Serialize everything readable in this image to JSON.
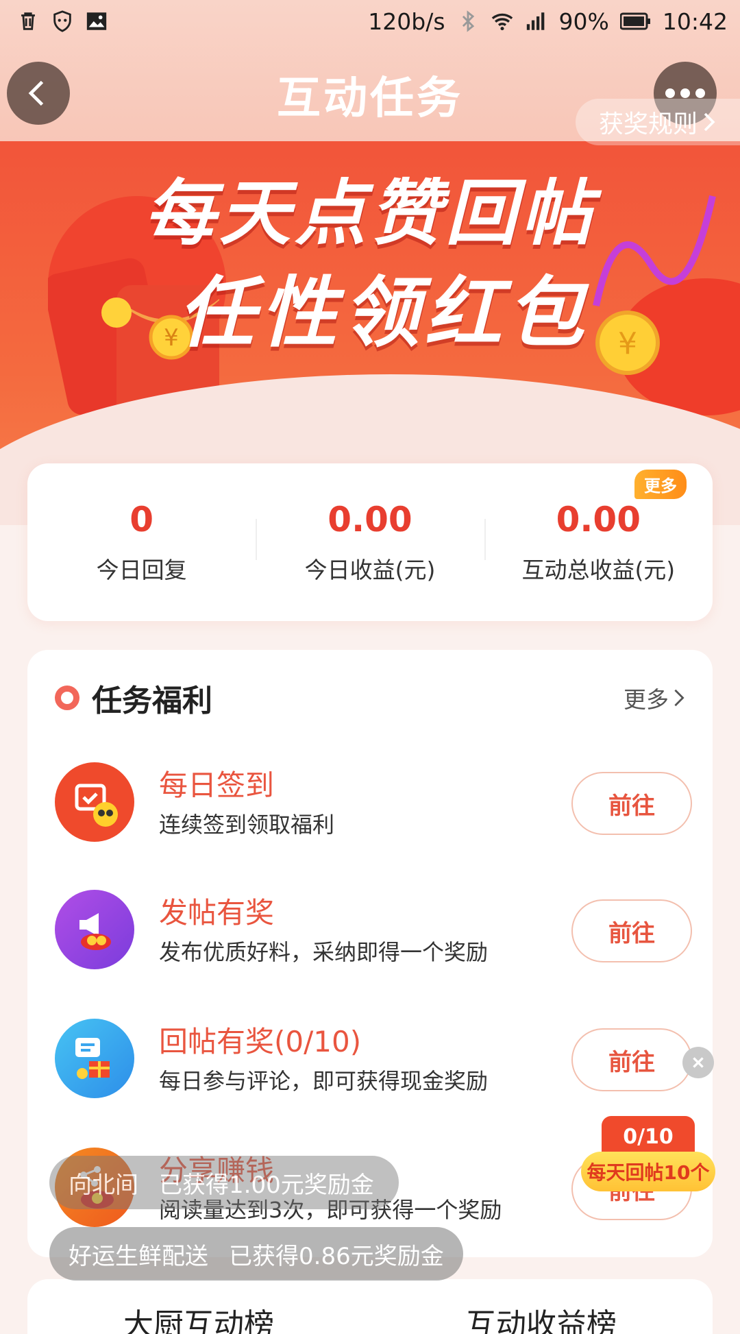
{
  "status_bar": {
    "net_speed": "120b/s",
    "battery": "90%",
    "time": "10:42"
  },
  "header": {
    "title": "互动任务",
    "rules": "获奖规则"
  },
  "banner": {
    "line1": "每天点赞回帖",
    "line2": "任性领红包"
  },
  "stats": [
    {
      "value": "0",
      "label": "今日回复"
    },
    {
      "value": "0.00",
      "label": "今日收益(元)"
    },
    {
      "value": "0.00",
      "label": "互动总收益(元)",
      "badge": "更多"
    }
  ],
  "tasks_section": {
    "title": "任务福利",
    "more": "更多",
    "items": [
      {
        "title": "每日签到",
        "desc": "连续签到领取福利",
        "button": "前往",
        "icon": "calendar-checkin-icon"
      },
      {
        "title": "发帖有奖",
        "desc": "发布优质好料，采纳即得一个奖励",
        "button": "前往",
        "icon": "megaphone-icon"
      },
      {
        "title": "回帖有奖(0/10)",
        "desc": "每日参与评论，即可获得现金奖励",
        "button": "前往",
        "icon": "chat-gift-icon"
      },
      {
        "title": "分享赚钱",
        "desc": "阅读量达到3次，即可获得一个奖励",
        "button": "前往",
        "icon": "share-redpacket-icon"
      }
    ]
  },
  "reply_float": {
    "count": "0/10",
    "label": "每天回帖10个"
  },
  "toasts": [
    {
      "user": "向北间",
      "msg": "已获得1.00元奖励金"
    },
    {
      "user": "好运生鲜配送",
      "msg": "已获得0.86元奖励金"
    }
  ],
  "bottom_tabs": [
    "大厨互动榜",
    "互动收益榜"
  ],
  "colors": {
    "accent": "#e9553f",
    "banner": "#f2553a",
    "value": "#e83e2f"
  }
}
